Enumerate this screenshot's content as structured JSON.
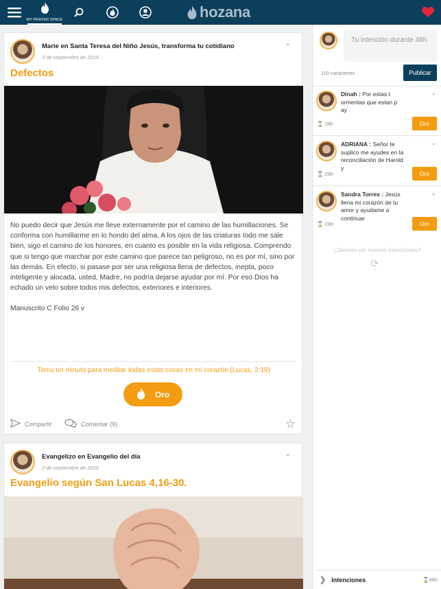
{
  "topbar": {
    "prayer_space_label": "MY PRAYER SPACE",
    "logo_text": "hozana",
    "icons": [
      "menu-icon",
      "flame-icon",
      "search-icon",
      "flame-outline-icon",
      "user-icon",
      "heart-icon"
    ]
  },
  "posts": [
    {
      "author": "Marie en Santa Teresa del Niño Jesús, transforma tu cotidiano",
      "date": "3 de septiembre de 2019",
      "title": "Defectos",
      "body": "No puedo decir que Jesús me lleve externamente por el camino de las humillaciones. Se conforma con humillarme en lo hondo del alma. A los ojos de las criaturas todo me sale bien, sigo el camino de los honores, en cuanto es posible en la vida religiosa. Comprendo que si tengo que marchar por este camino que parece tan peligroso, no es por mí, sino por las demás. En efecto, si pasase por ser una religiosa llena de defectos, inepta, poco inteligente y alocada, usted, Madre, no podría dejarse ayudar por mí. Por eso Dios ha echado un velo sobre todos mis defectos, exteriores e interiores.",
      "reference": "Manuscrito C Folio 26 v",
      "meditate": "Tomo un minuto para meditar todas estas cosas en mi corazón (Lucas, 2:19)",
      "pray_label": "Oro",
      "share_label": "Compartir",
      "comment_label": "Comentar (9)"
    },
    {
      "author": "Evangelizo en Evangelio del día",
      "date": "2 de septiembre de 2019",
      "title": "Evangelio según San Lucas 4,16-30."
    }
  ],
  "sidebar": {
    "compose_placeholder": "Tu intención durante 48h",
    "char_count": "110 carácteres",
    "publish_label": "Publicar",
    "intentions": [
      {
        "name": "Dinah :",
        "text": "Por estas t ormentas que estan p ay",
        "time": "29h",
        "pray_label": "Oro"
      },
      {
        "name": "ADRIANA :",
        "text": "Señor te suplico me ayudes en la reconciliación de Harold y",
        "time": "29h",
        "pray_label": "Oro"
      },
      {
        "name": "Sandra Torres :",
        "text": "Jesús llena mi corazón de tu amor y ayudame a continuar",
        "time": "29h",
        "pray_label": "Oro"
      }
    ],
    "more_intentions": "¿Deseas ver nuevas intenciones?",
    "footer_label": "Intenciones",
    "footer_time": "48h"
  },
  "colors": {
    "header": "#0c3f5c",
    "accent": "#f39c12",
    "heart": "#e0283a"
  }
}
